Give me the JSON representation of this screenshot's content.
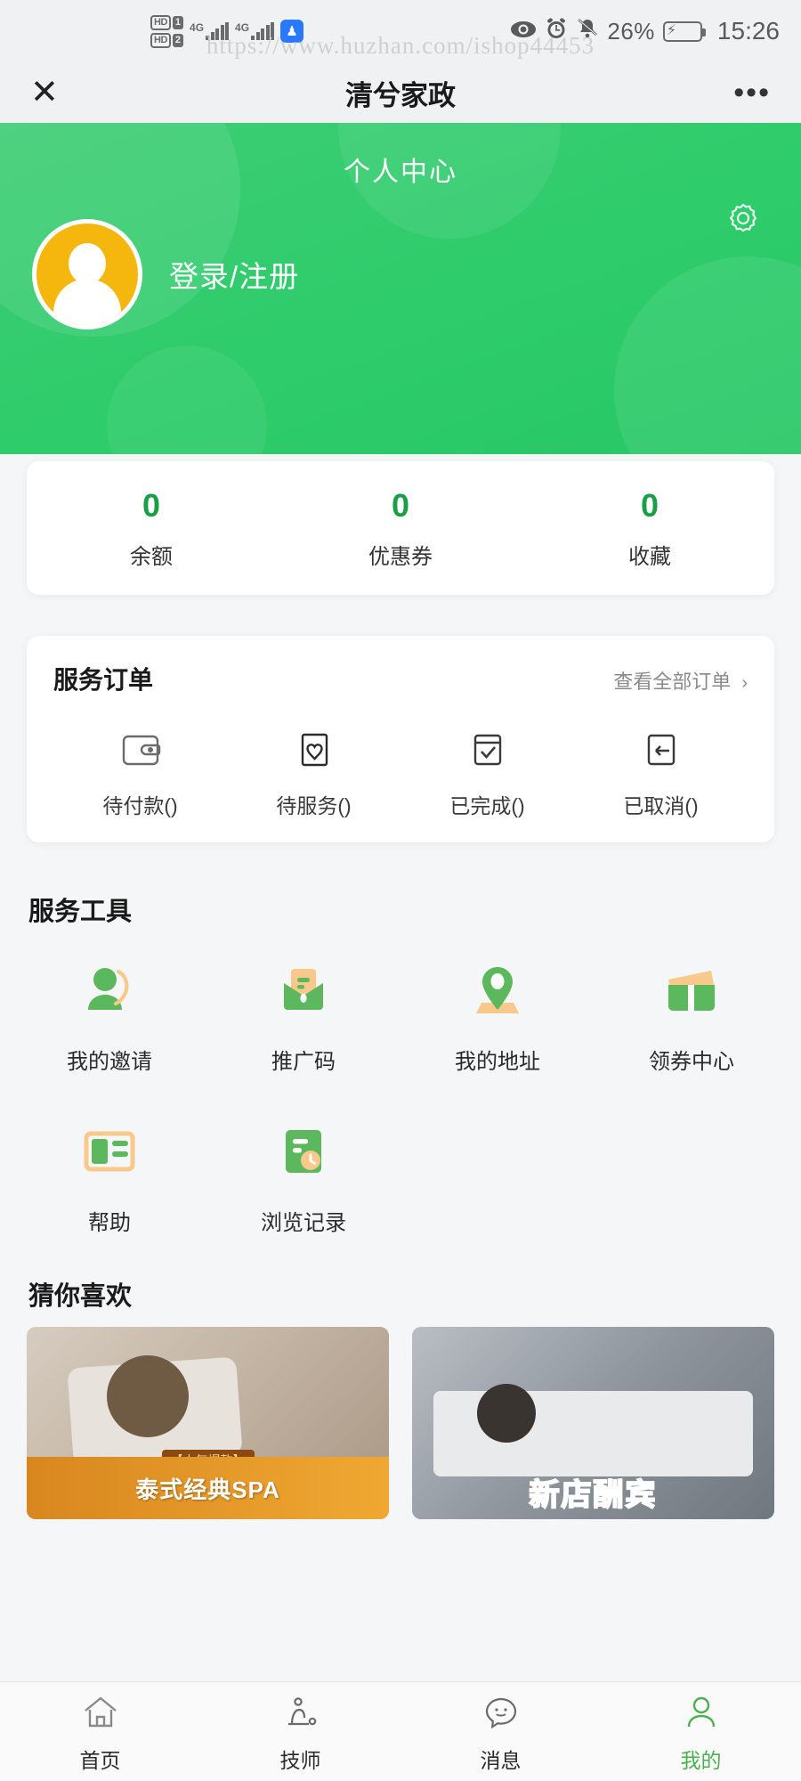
{
  "status_bar": {
    "hd1": "HD",
    "hd1_num": "1",
    "hd2": "HD",
    "hd2_num": "2",
    "net1": "4G",
    "net2": "4G",
    "battery_percent": "26%",
    "time": "15:26",
    "icons": [
      "eye-icon",
      "alarm-icon",
      "bell-muted-icon",
      "battery-charging-icon"
    ]
  },
  "watermark": "https://www.huzhan.com/ishop44453",
  "navbar": {
    "close_label": "✕",
    "title": "清兮家政",
    "more_label": "•••"
  },
  "hero": {
    "title": "个人中心",
    "login_label": "登录/注册",
    "settings_icon": "gear-icon",
    "bg_color": "#2ecc6b",
    "avatar_color": "#f5b60d"
  },
  "stats": {
    "items": [
      {
        "value": "0",
        "label": "余额"
      },
      {
        "value": "0",
        "label": "优惠券"
      },
      {
        "value": "0",
        "label": "收藏"
      }
    ],
    "value_color": "#1a9e46"
  },
  "orders": {
    "title": "服务订单",
    "view_all": "查看全部订单",
    "chevron": "›",
    "items": [
      {
        "label": "待付款()",
        "icon": "wallet-icon"
      },
      {
        "label": "待服务()",
        "icon": "heart-card-icon"
      },
      {
        "label": "已完成()",
        "icon": "checkbox-icon"
      },
      {
        "label": "已取消()",
        "icon": "return-arrow-icon"
      }
    ]
  },
  "tools": {
    "title": "服务工具",
    "row1": [
      {
        "label": "我的邀请",
        "icon": "user-invite-icon"
      },
      {
        "label": "推广码",
        "icon": "envelope-icon"
      },
      {
        "label": "我的地址",
        "icon": "location-pin-icon"
      },
      {
        "label": "领券中心",
        "icon": "ticket-icon"
      }
    ],
    "row2": [
      {
        "label": "帮助",
        "icon": "book-icon"
      },
      {
        "label": "浏览记录",
        "icon": "history-icon"
      }
    ]
  },
  "recommend": {
    "title": "猜你喜欢",
    "cards": [
      {
        "tag": "【人气爆款】",
        "banner": "泰式经典SPA",
        "image": "massage-photo-1"
      },
      {
        "tag": "",
        "banner": "新店酬宾",
        "image": "massage-photo-2"
      }
    ]
  },
  "tabbar": {
    "items": [
      {
        "label": "首页",
        "icon": "home-icon",
        "active": false
      },
      {
        "label": "技师",
        "icon": "technician-icon",
        "active": false
      },
      {
        "label": "消息",
        "icon": "message-icon",
        "active": false
      },
      {
        "label": "我的",
        "icon": "user-icon",
        "active": true
      }
    ],
    "active_color": "#4caf50"
  }
}
